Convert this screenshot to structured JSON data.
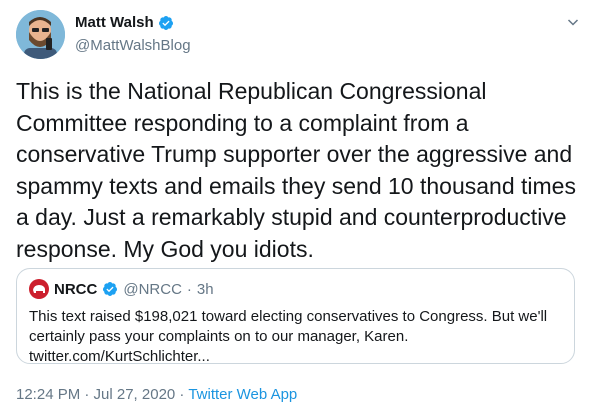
{
  "author": {
    "name": "Matt Walsh",
    "handle": "@MattWalshBlog"
  },
  "tweet": {
    "text": "This is the National Republican Congressional Committee responding to a complaint from a conservative Trump supporter over the aggressive and spammy texts and emails they send 10 thousand times a day. Just a remarkably stupid and counterproductive response. My God you idiots."
  },
  "quote": {
    "name": "NRCC",
    "handle": "@NRCC",
    "separator": "·",
    "time": "3h",
    "text_line1": "This text raised $198,021 toward electing conservatives to Congress. But we'll",
    "text_line2": "certainly pass your complaints on to our manager, Karen.",
    "text_line3": "twitter.com/KurtSchlichter..."
  },
  "meta": {
    "timestamp": "12:24 PM · Jul 27, 2020 · ",
    "source": "Twitter Web App"
  },
  "colors": {
    "link": "#1b95e0",
    "verified": "#1da1f2",
    "muted": "#657786",
    "border": "#ccd6dd",
    "nrcc_red": "#cc1f2d"
  },
  "icons": {
    "verified": "verified-badge-icon",
    "more": "chevron-down-icon"
  }
}
